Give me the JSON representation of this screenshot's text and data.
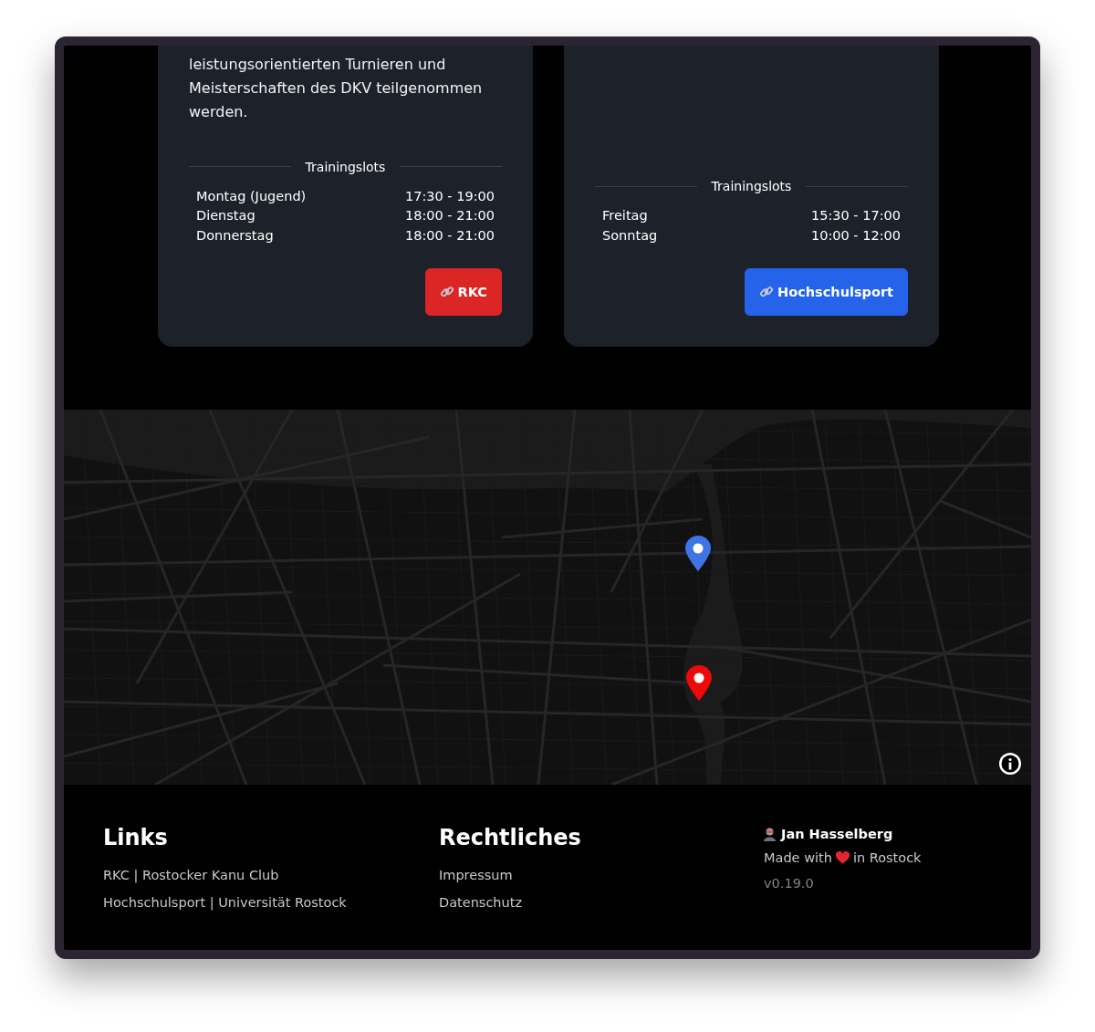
{
  "cards": [
    {
      "description": "leistungsorientierten Turnieren und Meisterschaften des DKV teilgenommen werden.",
      "slots_title": "Trainingslots",
      "slots": [
        {
          "day": "Montag (Jugend)",
          "time": "17:30 - 19:00"
        },
        {
          "day": "Dienstag",
          "time": "18:00 - 21:00"
        },
        {
          "day": "Donnerstag",
          "time": "18:00 - 21:00"
        }
      ],
      "button": {
        "label": "RKC",
        "color": "#dc2626"
      }
    },
    {
      "slots_title": "Trainingslots",
      "slots": [
        {
          "day": "Freitag",
          "time": "15:30 - 17:00"
        },
        {
          "day": "Sonntag",
          "time": "10:00 - 12:00"
        }
      ],
      "button": {
        "label": "Hochschulsport",
        "color": "#2563eb"
      }
    }
  ],
  "footer": {
    "columns": [
      {
        "heading": "Links",
        "links": [
          "RKC | Rostocker Kanu Club",
          "Hochschulsport | Universität Rostock"
        ]
      },
      {
        "heading": "Rechtliches",
        "links": [
          "Impressum",
          "Datenschutz"
        ]
      }
    ],
    "author": "Jan Hasselberg",
    "made_with": "Made with",
    "made_in": "in Rostock",
    "version": "v0.19.0"
  }
}
